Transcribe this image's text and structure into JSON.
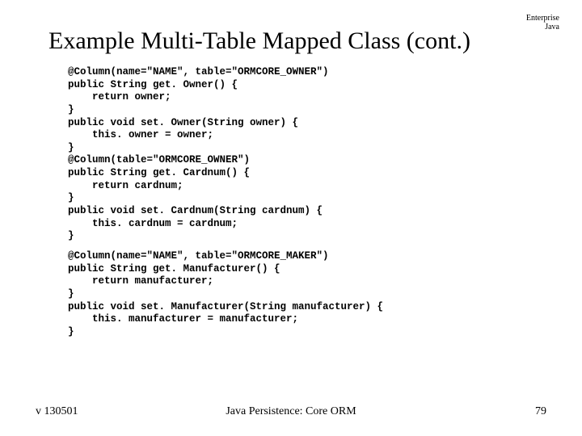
{
  "corner": {
    "line1": "Enterprise",
    "line2": "Java"
  },
  "title": "Example Multi-Table Mapped Class (cont.)",
  "code_block_1": "@Column(name=\"NAME\", table=\"ORMCORE_OWNER\")\npublic String get. Owner() {\n    return owner;\n}\npublic void set. Owner(String owner) {\n    this. owner = owner;\n}\n@Column(table=\"ORMCORE_OWNER\")\npublic String get. Cardnum() {\n    return cardnum;\n}\npublic void set. Cardnum(String cardnum) {\n    this. cardnum = cardnum;\n}",
  "code_block_2": "@Column(name=\"NAME\", table=\"ORMCORE_MAKER\")\npublic String get. Manufacturer() {\n    return manufacturer;\n}\npublic void set. Manufacturer(String manufacturer) {\n    this. manufacturer = manufacturer;\n}",
  "footer": {
    "left": "v 130501",
    "center": "Java Persistence: Core ORM",
    "right": "79"
  }
}
